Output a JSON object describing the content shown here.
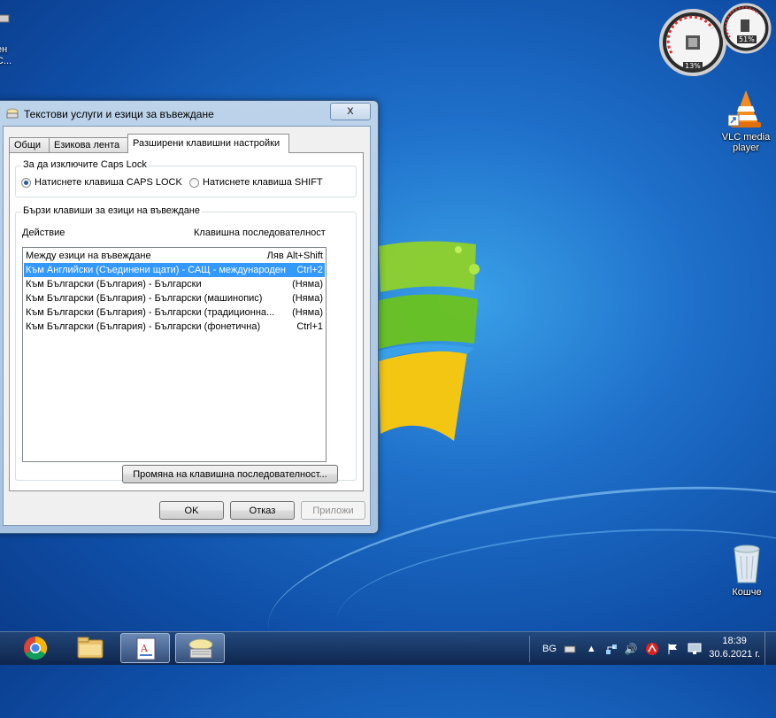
{
  "desktop": {
    "left_partial_label_line1": "ен",
    "left_partial_label_line2": "С...",
    "vlc_label": "VLC media player",
    "recycle_label": "Кошче"
  },
  "gadget": {
    "cpu_percent": "13%",
    "memory_percent": "51%"
  },
  "dialog": {
    "title": "Текстови услуги и езици за въвеждане",
    "close_symbol": "x",
    "tabs": [
      "Общи",
      "Езикова лента",
      "Разширени клавишни настройки"
    ],
    "caps_group_label": "За да изключите Caps Lock",
    "caps_option1": "Натиснете клавиша CAPS LOCK",
    "caps_option2": "Натиснете клавиша SHIFT",
    "hotkeys_group_label": "Бързи клавиши за езици на въвеждане",
    "col_action": "Действие",
    "col_sequence": "Клавишна последователност",
    "rows": [
      {
        "action": "Между езици на въвеждане",
        "keys": "Ляв Alt+Shift"
      },
      {
        "action": "Към Английски (Съединени щати) - САЩ - международен",
        "keys": "Ctrl+2"
      },
      {
        "action": "Към Български (България) - Български",
        "keys": "(Няма)"
      },
      {
        "action": "Към Български (България) - Български (машинопис)",
        "keys": "(Няма)"
      },
      {
        "action": "Към Български (България) - Български (традиционна...",
        "keys": "(Няма)"
      },
      {
        "action": "Към Български (България) - Български (фонетична)",
        "keys": "Ctrl+1"
      }
    ],
    "change_button": "Промяна на клавишна последователност...",
    "ok": "OK",
    "cancel": "Отказ",
    "apply": "Приложи"
  },
  "taskbar": {
    "lang": "BG",
    "time": "18:39",
    "date": "30.6.2021 г."
  }
}
